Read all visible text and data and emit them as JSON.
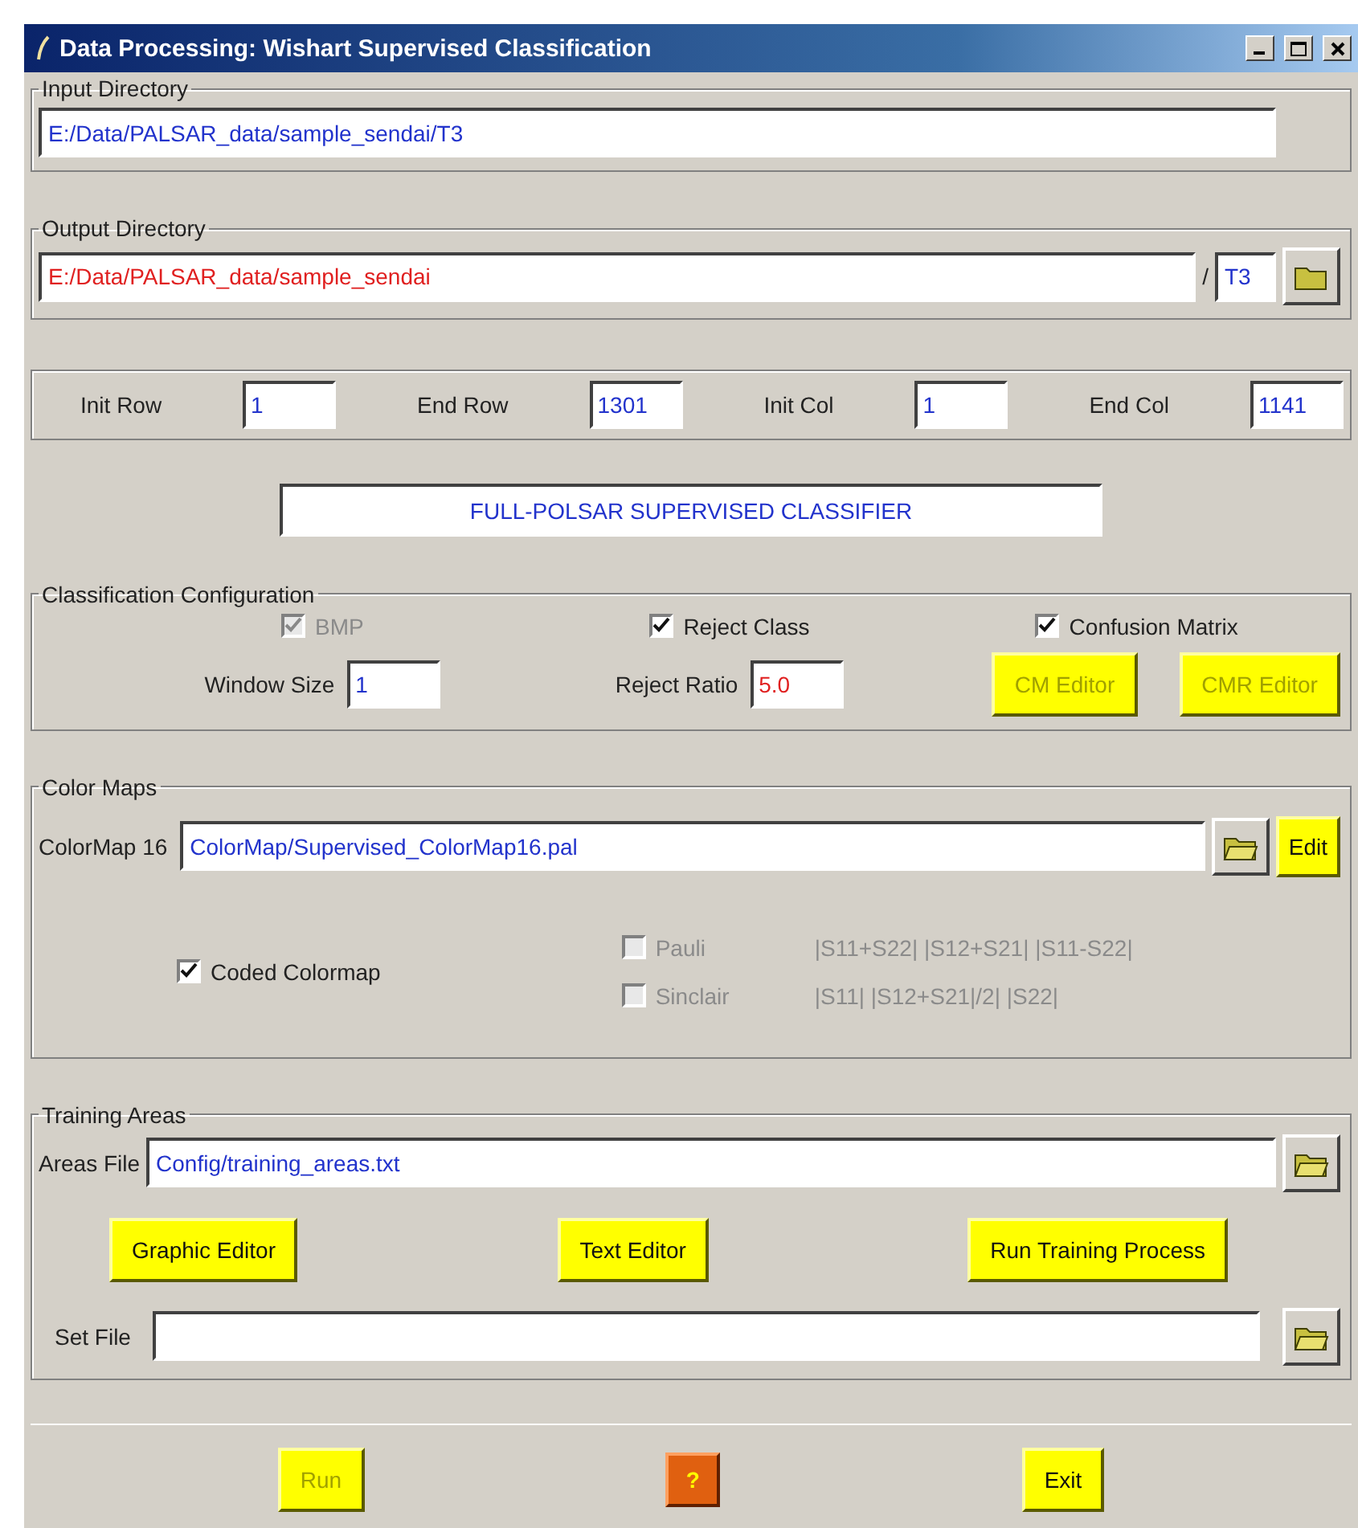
{
  "window": {
    "title": "Data Processing: Wishart Supervised Classification"
  },
  "input_directory": {
    "label": "Input Directory",
    "value": "E:/Data/PALSAR_data/sample_sendai/T3"
  },
  "output_directory": {
    "label": "Output Directory",
    "value": "E:/Data/PALSAR_data/sample_sendai",
    "separator": "/",
    "subdir": "T3"
  },
  "range": [
    {
      "label": "Init Row",
      "value": "1"
    },
    {
      "label": "End Row",
      "value": "1301"
    },
    {
      "label": "Init Col",
      "value": "1"
    },
    {
      "label": "End Col",
      "value": "1141"
    }
  ],
  "classifier_label": "FULL-POLSAR SUPERVISED CLASSIFIER",
  "classification": {
    "label": "Classification Configuration",
    "checkboxes": [
      {
        "label": "BMP",
        "checked": true,
        "disabled": true
      },
      {
        "label": "Reject Class",
        "checked": true,
        "disabled": false
      },
      {
        "label": "Confusion Matrix",
        "checked": true,
        "disabled": false
      }
    ],
    "window_size": {
      "label": "Window Size",
      "value": "1"
    },
    "reject_ratio": {
      "label": "Reject Ratio",
      "value": "5.0"
    },
    "buttons": [
      {
        "label": "CM Editor",
        "disabled": true
      },
      {
        "label": "CMR Editor",
        "disabled": true
      }
    ]
  },
  "color_maps": {
    "label": "Color Maps",
    "colormap": {
      "label": "ColorMap 16",
      "value": "ColorMap/Supervised_ColorMap16.pal"
    },
    "edit_button": "Edit",
    "coded": {
      "label": "Coded Colormap",
      "checked": true
    },
    "options": [
      {
        "label": "Pauli",
        "formula": "|S11+S22| |S12+S21| |S11-S22|",
        "checked": false,
        "disabled": true
      },
      {
        "label": "Sinclair",
        "formula": "|S11| |S12+S21|/2| |S22|",
        "checked": false,
        "disabled": true
      }
    ]
  },
  "training": {
    "label": "Training Areas",
    "areas_file": {
      "label": "Areas File",
      "value": "Config/training_areas.txt"
    },
    "buttons": [
      "Graphic Editor",
      "Text Editor",
      "Run Training Process"
    ],
    "set_file": {
      "label": "Set File"
    }
  },
  "footer": [
    {
      "label": "Run",
      "kind": "action",
      "disabled": true
    },
    {
      "label": "?",
      "kind": "help"
    },
    {
      "label": "Exit",
      "kind": "action",
      "disabled": false
    }
  ]
}
